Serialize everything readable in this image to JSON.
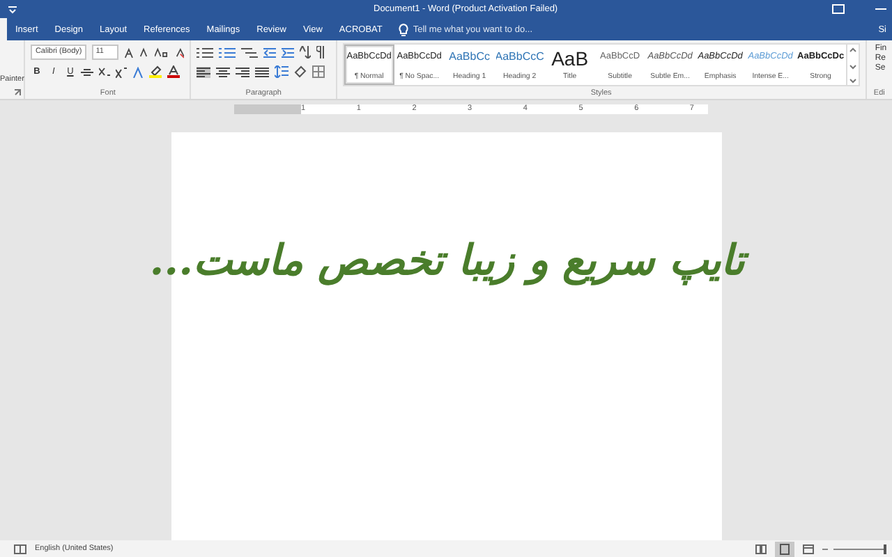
{
  "window": {
    "title": "Document1 - Word (Product Activation Failed)"
  },
  "tabs": [
    {
      "label": "Insert",
      "selected": false
    },
    {
      "label": "Design",
      "selected": false
    },
    {
      "label": "Layout",
      "selected": false
    },
    {
      "label": "References",
      "selected": false
    },
    {
      "label": "Mailings",
      "selected": false
    },
    {
      "label": "Review",
      "selected": false
    },
    {
      "label": "View",
      "selected": false
    },
    {
      "label": "ACROBAT",
      "selected": false
    }
  ],
  "tell_me": {
    "placeholder": "Tell me what you want to do..."
  },
  "sign_in": "Si",
  "clipboard": {
    "label": "Painter"
  },
  "font": {
    "family": "Calibri (Body)",
    "size": "11",
    "label": "Font",
    "buttons": [
      "B",
      "I",
      "U"
    ]
  },
  "paragraph": {
    "label": "Paragraph"
  },
  "styles": {
    "label": "Styles",
    "items": [
      {
        "preview": "AaBbCcDd",
        "name": "¶ Normal",
        "kind": "normal",
        "selected": true
      },
      {
        "preview": "AaBbCcDd",
        "name": "¶ No Spac...",
        "kind": "normal",
        "selected": false
      },
      {
        "preview": "AaBbCc",
        "name": "Heading 1",
        "kind": "heading",
        "selected": false
      },
      {
        "preview": "AaBbCcC",
        "name": "Heading 2",
        "kind": "heading",
        "selected": false
      },
      {
        "preview": "AaB",
        "name": "Title",
        "kind": "title",
        "selected": false
      },
      {
        "preview": "AaBbCcD",
        "name": "Subtitle",
        "kind": "subtitle",
        "selected": false
      },
      {
        "preview": "AaBbCcDd",
        "name": "Subtle Em...",
        "kind": "subtle",
        "selected": false
      },
      {
        "preview": "AaBbCcDd",
        "name": "Emphasis",
        "kind": "emphasis",
        "selected": false
      },
      {
        "preview": "AaBbCcDd",
        "name": "Intense E...",
        "kind": "intense",
        "selected": false
      },
      {
        "preview": "AaBbCcDc",
        "name": "Strong",
        "kind": "strong",
        "selected": false
      }
    ]
  },
  "editing": {
    "items": [
      "Fin",
      "Re",
      "Se"
    ],
    "label": "Edi"
  },
  "ruler": [
    "1",
    "1",
    "2",
    "3",
    "4",
    "5",
    "6",
    "7"
  ],
  "document": {
    "text": "تایپ سریع و زیبا تخصص ماست..."
  },
  "status_bar": {
    "language": "English (United States)"
  }
}
